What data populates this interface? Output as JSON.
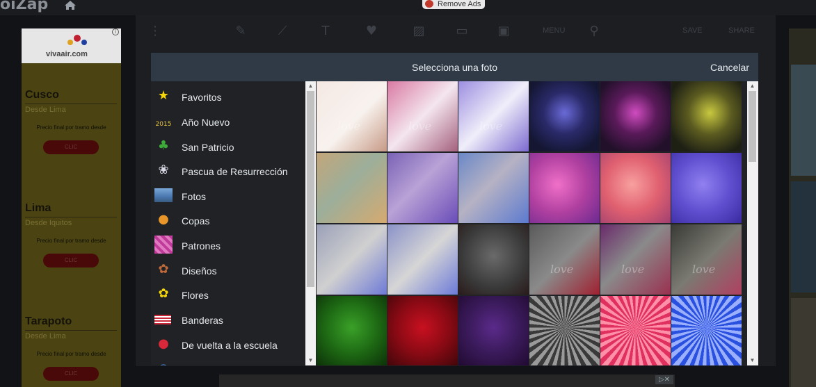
{
  "topbar": {
    "logo": "oiZap",
    "remove_ads": "Remove Ads"
  },
  "toolbar": {
    "menu_label": "MENU",
    "save_label": "SAVE",
    "share_label": "SHARE"
  },
  "ad": {
    "brand": "vivaair.com",
    "routes": [
      {
        "city": "Cusco",
        "from": "Desde Lima",
        "price_note": "Precio final por tramo desde",
        "cta": "CLIC"
      },
      {
        "city": "Lima",
        "from": "Desde Iquitos",
        "price_note": "Precio final por tramo desde",
        "cta": "CLIC"
      },
      {
        "city": "Tarapoto",
        "from": "Desde Lima",
        "price_note": "Precio final por tramo desde",
        "cta": "CLIC"
      }
    ]
  },
  "modal": {
    "title": "Selecciona una foto",
    "cancel": "Cancelar",
    "categories": [
      {
        "label": "Favoritos",
        "icon": "star-icon"
      },
      {
        "label": "Año Nuevo",
        "icon": "new-year-2015-icon"
      },
      {
        "label": "San Patricio",
        "icon": "shamrock-icon"
      },
      {
        "label": "Pascua de Resurrección",
        "icon": "bunny-icon"
      },
      {
        "label": "Fotos",
        "icon": "landscape-photo-icon"
      },
      {
        "label": "Copas",
        "icon": "teddy-bear-icon"
      },
      {
        "label": "Patrones",
        "icon": "pattern-icon"
      },
      {
        "label": "Diseños",
        "icon": "designs-icon"
      },
      {
        "label": "Flores",
        "icon": "flower-icon"
      },
      {
        "label": "Banderas",
        "icon": "flag-icon"
      },
      {
        "label": "De vuelta a la escuela",
        "icon": "school-apple-icon"
      },
      {
        "label": "",
        "icon": "globe-icon"
      }
    ],
    "thumbnails": [
      {
        "bg": "linear-gradient(135deg,#f4e8e4,#f8f2ee 55%,#c79a86)",
        "text": "love"
      },
      {
        "bg": "linear-gradient(135deg,#d97aa3,#f4e6ee 50%,#a4607e)",
        "text": "love"
      },
      {
        "bg": "linear-gradient(135deg,#9c8ee0,#f0eefa 50%,#7c6ad0)",
        "text": "love"
      },
      {
        "bg": "radial-gradient(circle at 50% 45%,#6a6ad8,#2a2a6a 40%,#141632 80%)",
        "text": ""
      },
      {
        "bg": "radial-gradient(circle at 50% 45%,#d04cc0,#5a1a5a 40%,#22102a 80%)",
        "text": ""
      },
      {
        "bg": "radial-gradient(circle at 55% 45%,#c8c840,#5a5a20 40%,#1e2014 80%)",
        "text": ""
      },
      {
        "bg": "linear-gradient(135deg,#c3a67a,#9cae9a 45%,#d6aa70)",
        "text": ""
      },
      {
        "bg": "linear-gradient(135deg,#7a62b6,#b9a2d6 45%,#6a4cb8)",
        "text": ""
      },
      {
        "bg": "linear-gradient(135deg,#6a88c8,#b6b2c4 45%,#5c7acf)",
        "text": ""
      },
      {
        "bg": "radial-gradient(circle at 40% 45%,#f070c8,#b040a0 50%,#6a2a90)",
        "text": ""
      },
      {
        "bg": "radial-gradient(circle at 45% 45%,#f8a0a0,#e06070 50%,#a04070)",
        "text": ""
      },
      {
        "bg": "radial-gradient(circle at 45% 45%,#9080f0,#6050d0 50%,#3a2aa0)",
        "text": ""
      },
      {
        "bg": "linear-gradient(135deg,#9aa0b8,#d0d0d0 50%,#6e7ad6)",
        "text": ""
      },
      {
        "bg": "linear-gradient(135deg,#8a92c8,#d6d6d6 50%,#6c7ad8)",
        "text": ""
      },
      {
        "bg": "radial-gradient(circle at 50% 45%,#6a6a6a,#3a3a3a 60%,#2a1a1a)",
        "text": ""
      },
      {
        "bg": "linear-gradient(135deg,#5a5a5a,#8a8a8a 50%,#a02030)",
        "text": "love"
      },
      {
        "bg": "linear-gradient(135deg,#6a2a6a,#8a8a8a 45%,#9a3050)",
        "text": "love"
      },
      {
        "bg": "linear-gradient(135deg,#3a3a36,#7a7a72 50%,#b04060)",
        "text": "love"
      },
      {
        "bg": "radial-gradient(circle at 50% 45%,#3aa028,#1e6a14 50%,#0c3008)",
        "text": ""
      },
      {
        "bg": "radial-gradient(circle at 50% 45%,#c81020,#8a0a14 50%,#40060a)",
        "text": ""
      },
      {
        "bg": "radial-gradient(circle at 50% 45%,#5a2a8a,#3a1a5a 50%,#200a30)",
        "text": ""
      },
      {
        "bg": "repeating-conic-gradient(from 0deg at 50% 45%,#9a9a9a 0deg 6deg,#3a3a3a 6deg 12deg)",
        "text": ""
      },
      {
        "bg": "repeating-conic-gradient(from 0deg at 50% 45%,#ff90a8 0deg 6deg,#e03060 6deg 12deg)",
        "text": ""
      },
      {
        "bg": "repeating-conic-gradient(from 0deg at 50% 45%,#9ab0ff 0deg 6deg,#2a50e0 6deg 12deg)",
        "text": ""
      }
    ]
  }
}
